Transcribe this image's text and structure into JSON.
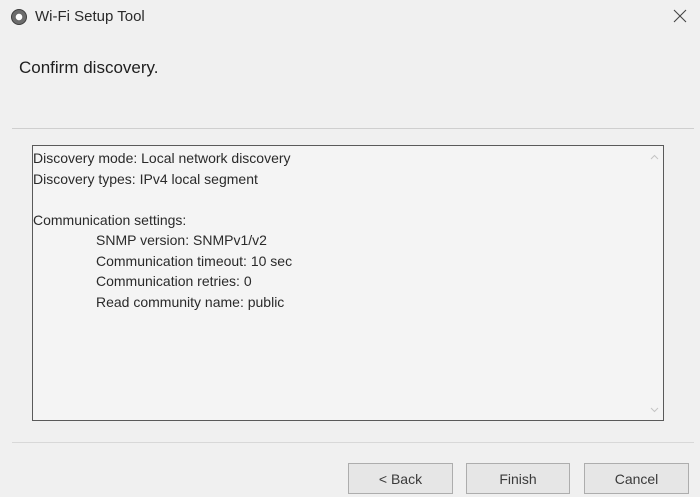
{
  "window": {
    "title": "Wi-Fi Setup Tool",
    "app_icon": "app-disc-icon",
    "close_icon": "close-icon"
  },
  "header": {
    "heading": "Confirm discovery."
  },
  "summary": {
    "lines": [
      {
        "text": "Discovery mode: Local network discovery",
        "indent": false
      },
      {
        "text": "Discovery types: IPv4 local segment",
        "indent": false
      },
      {
        "text": "",
        "indent": false
      },
      {
        "text": "Communication settings:",
        "indent": false
      },
      {
        "text": "SNMP version: SNMPv1/v2",
        "indent": true
      },
      {
        "text": "Communication timeout: 10 sec",
        "indent": true
      },
      {
        "text": "Communication retries: 0",
        "indent": true
      },
      {
        "text": "Read community name: public",
        "indent": true
      }
    ],
    "scroll_up_icon": "chevron-up-icon",
    "scroll_down_icon": "chevron-down-icon"
  },
  "buttons": {
    "back_label": "< Back",
    "finish_label": "Finish",
    "cancel_label": "Cancel"
  },
  "colors": {
    "window_bg": "#f0f0f0",
    "text": "#1f1f1f",
    "button_bg": "#e6e6e6",
    "button_border": "#adadad",
    "box_border": "#5a5a5a"
  }
}
